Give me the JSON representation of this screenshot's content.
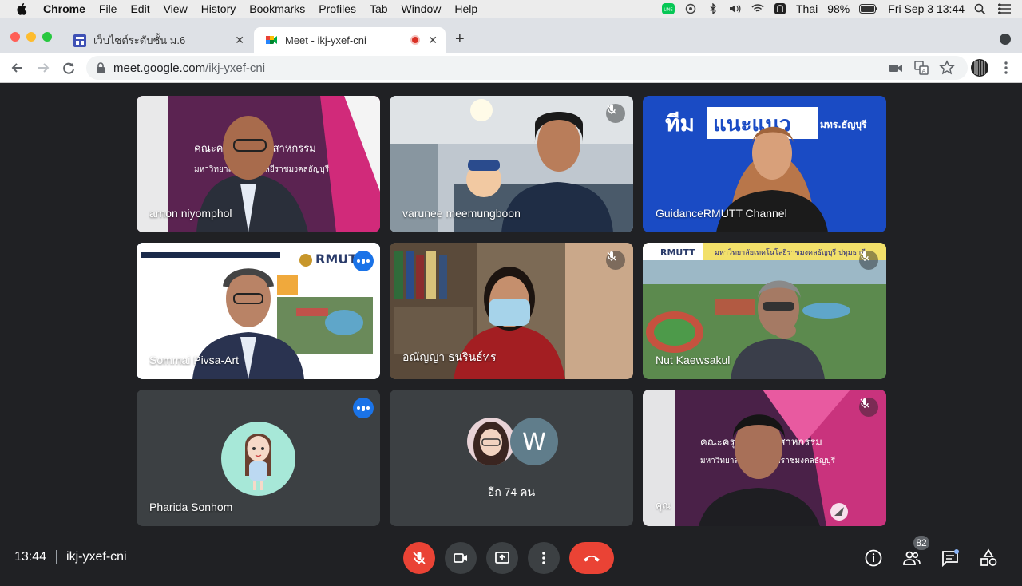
{
  "menubar": {
    "app": "Chrome",
    "items": [
      "File",
      "Edit",
      "View",
      "History",
      "Bookmarks",
      "Profiles",
      "Tab",
      "Window",
      "Help"
    ],
    "input_source": "Thai",
    "battery": "98%",
    "datetime": "Fri Sep 3  13:44"
  },
  "tabs": [
    {
      "title": "เว็บไซต์ระดับชั้น ม.6",
      "active": false
    },
    {
      "title": "Meet - ikj-yxef-cni",
      "active": true
    }
  ],
  "address": {
    "host": "meet.google.com",
    "path": "/ikj-yxef-cni"
  },
  "participants": [
    {
      "name": "arnon niyomphol",
      "muted": false,
      "speaking": false,
      "type": "video"
    },
    {
      "name": "varunee meemungboon",
      "muted": true,
      "speaking": false,
      "type": "video"
    },
    {
      "name": "GuidanceRMUTT Channel",
      "muted": false,
      "speaking": false,
      "type": "video"
    },
    {
      "name": "Sommai Pivsa-Art",
      "muted": false,
      "speaking": true,
      "type": "video"
    },
    {
      "name": "อณัญญา ธนรินธ์ทร",
      "muted": true,
      "speaking": false,
      "type": "video"
    },
    {
      "name": "Nut Kaewsakul",
      "muted": true,
      "speaking": false,
      "type": "video"
    },
    {
      "name": "Pharida Sonhom",
      "muted": false,
      "speaking": true,
      "type": "avatar"
    },
    {
      "name": "อีก 74 คน",
      "muted": false,
      "speaking": false,
      "type": "others",
      "avatar_letter": "W"
    },
    {
      "name": "คุณ",
      "muted": true,
      "speaking": false,
      "type": "self"
    }
  ],
  "video_text": {
    "arnon_banner": "คณะครุศาสตร์อุตสาหกรรม",
    "arnon_sub": "มหาวิทยาลัยเทคโนโลยีราชมงคลธัญบุรี",
    "guidance_banner_a": "ทีม",
    "guidance_banner_b": "แนะแนว",
    "guidance_banner_c": "มทร.ธัญบุรี",
    "nut_banner": "มหาวิทยาลัยเทคโนโลยีราชมงคลธัญบุรี ปทุมธานี",
    "rmutt": "RMUTT"
  },
  "bottom": {
    "time": "13:44",
    "meeting_code": "ikj-yxef-cni",
    "people_count": "82"
  },
  "colors": {
    "meet_bg": "#202124",
    "tile_bg": "#3c4043",
    "end_call": "#ea4335",
    "speaking": "#1a73e8",
    "highlight": "#8ab4f8"
  }
}
